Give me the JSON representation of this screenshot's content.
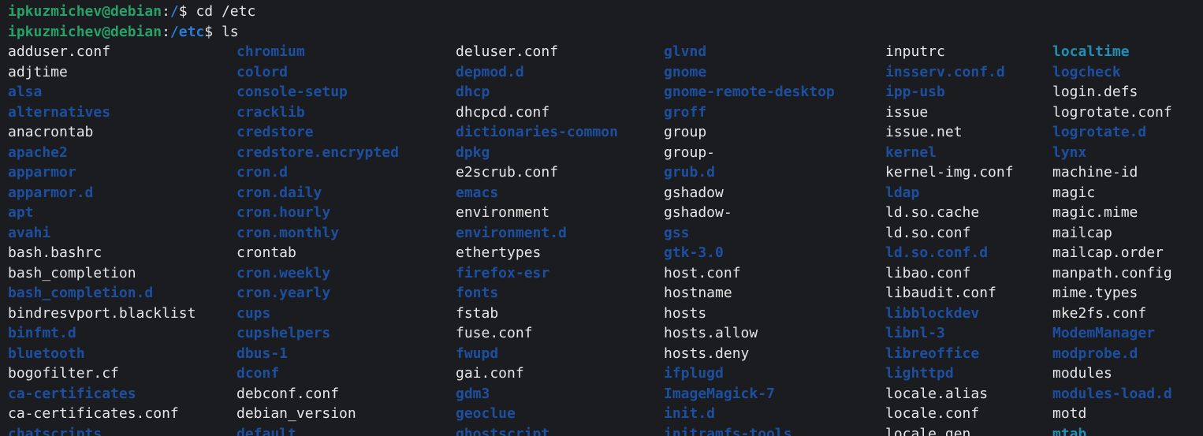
{
  "terminal": {
    "lines": [
      {
        "user_host": "ipkuzmichev@debian",
        "colon": ":",
        "path": "/",
        "dollar": "$ ",
        "command": "cd /etc"
      },
      {
        "user_host": "ipkuzmichev@debian",
        "colon": ":",
        "path": "/etc",
        "dollar": "$ ",
        "command": "ls"
      }
    ],
    "columns": [
      [
        {
          "name": "adduser.conf",
          "kind": "file"
        },
        {
          "name": "adjtime",
          "kind": "file"
        },
        {
          "name": "alsa",
          "kind": "dir"
        },
        {
          "name": "alternatives",
          "kind": "dir"
        },
        {
          "name": "anacrontab",
          "kind": "file"
        },
        {
          "name": "apache2",
          "kind": "dir"
        },
        {
          "name": "apparmor",
          "kind": "dir"
        },
        {
          "name": "apparmor.d",
          "kind": "dir"
        },
        {
          "name": "apt",
          "kind": "dir"
        },
        {
          "name": "avahi",
          "kind": "dir"
        },
        {
          "name": "bash.bashrc",
          "kind": "file"
        },
        {
          "name": "bash_completion",
          "kind": "file"
        },
        {
          "name": "bash_completion.d",
          "kind": "dir"
        },
        {
          "name": "bindresvport.blacklist",
          "kind": "file"
        },
        {
          "name": "binfmt.d",
          "kind": "dir"
        },
        {
          "name": "bluetooth",
          "kind": "dir"
        },
        {
          "name": "bogofilter.cf",
          "kind": "file"
        },
        {
          "name": "ca-certificates",
          "kind": "dir"
        },
        {
          "name": "ca-certificates.conf",
          "kind": "file"
        },
        {
          "name": "chatscripts",
          "kind": "dir"
        }
      ],
      [
        {
          "name": "chromium",
          "kind": "dir"
        },
        {
          "name": "colord",
          "kind": "dir"
        },
        {
          "name": "console-setup",
          "kind": "dir"
        },
        {
          "name": "cracklib",
          "kind": "dir"
        },
        {
          "name": "credstore",
          "kind": "dir"
        },
        {
          "name": "credstore.encrypted",
          "kind": "dir"
        },
        {
          "name": "cron.d",
          "kind": "dir"
        },
        {
          "name": "cron.daily",
          "kind": "dir"
        },
        {
          "name": "cron.hourly",
          "kind": "dir"
        },
        {
          "name": "cron.monthly",
          "kind": "dir"
        },
        {
          "name": "crontab",
          "kind": "file"
        },
        {
          "name": "cron.weekly",
          "kind": "dir"
        },
        {
          "name": "cron.yearly",
          "kind": "dir"
        },
        {
          "name": "cups",
          "kind": "dir"
        },
        {
          "name": "cupshelpers",
          "kind": "dir"
        },
        {
          "name": "dbus-1",
          "kind": "dir"
        },
        {
          "name": "dconf",
          "kind": "dir"
        },
        {
          "name": "debconf.conf",
          "kind": "file"
        },
        {
          "name": "debian_version",
          "kind": "file"
        },
        {
          "name": "default",
          "kind": "dir"
        }
      ],
      [
        {
          "name": "deluser.conf",
          "kind": "file"
        },
        {
          "name": "depmod.d",
          "kind": "dir"
        },
        {
          "name": "dhcp",
          "kind": "dir"
        },
        {
          "name": "dhcpcd.conf",
          "kind": "file"
        },
        {
          "name": "dictionaries-common",
          "kind": "dir"
        },
        {
          "name": "dpkg",
          "kind": "dir"
        },
        {
          "name": "e2scrub.conf",
          "kind": "file"
        },
        {
          "name": "emacs",
          "kind": "dir"
        },
        {
          "name": "environment",
          "kind": "file"
        },
        {
          "name": "environment.d",
          "kind": "dir"
        },
        {
          "name": "ethertypes",
          "kind": "file"
        },
        {
          "name": "firefox-esr",
          "kind": "dir"
        },
        {
          "name": "fonts",
          "kind": "dir"
        },
        {
          "name": "fstab",
          "kind": "file"
        },
        {
          "name": "fuse.conf",
          "kind": "file"
        },
        {
          "name": "fwupd",
          "kind": "dir"
        },
        {
          "name": "gai.conf",
          "kind": "file"
        },
        {
          "name": "gdm3",
          "kind": "dir"
        },
        {
          "name": "geoclue",
          "kind": "dir"
        },
        {
          "name": "ghostscript",
          "kind": "dir"
        }
      ],
      [
        {
          "name": "glvnd",
          "kind": "dir"
        },
        {
          "name": "gnome",
          "kind": "dir"
        },
        {
          "name": "gnome-remote-desktop",
          "kind": "dir"
        },
        {
          "name": "groff",
          "kind": "dir"
        },
        {
          "name": "group",
          "kind": "file"
        },
        {
          "name": "group-",
          "kind": "file"
        },
        {
          "name": "grub.d",
          "kind": "dir"
        },
        {
          "name": "gshadow",
          "kind": "file"
        },
        {
          "name": "gshadow-",
          "kind": "file"
        },
        {
          "name": "gss",
          "kind": "dir"
        },
        {
          "name": "gtk-3.0",
          "kind": "dir"
        },
        {
          "name": "host.conf",
          "kind": "file"
        },
        {
          "name": "hostname",
          "kind": "file"
        },
        {
          "name": "hosts",
          "kind": "file"
        },
        {
          "name": "hosts.allow",
          "kind": "file"
        },
        {
          "name": "hosts.deny",
          "kind": "file"
        },
        {
          "name": "ifplugd",
          "kind": "dir"
        },
        {
          "name": "ImageMagick-7",
          "kind": "dir"
        },
        {
          "name": "init.d",
          "kind": "dir"
        },
        {
          "name": "initramfs-tools",
          "kind": "dir"
        }
      ],
      [
        {
          "name": "inputrc",
          "kind": "file"
        },
        {
          "name": "insserv.conf.d",
          "kind": "dir"
        },
        {
          "name": "ipp-usb",
          "kind": "dir"
        },
        {
          "name": "issue",
          "kind": "file"
        },
        {
          "name": "issue.net",
          "kind": "file"
        },
        {
          "name": "kernel",
          "kind": "dir"
        },
        {
          "name": "kernel-img.conf",
          "kind": "file"
        },
        {
          "name": "ldap",
          "kind": "dir"
        },
        {
          "name": "ld.so.cache",
          "kind": "file"
        },
        {
          "name": "ld.so.conf",
          "kind": "file"
        },
        {
          "name": "ld.so.conf.d",
          "kind": "dir"
        },
        {
          "name": "libao.conf",
          "kind": "file"
        },
        {
          "name": "libaudit.conf",
          "kind": "file"
        },
        {
          "name": "libblockdev",
          "kind": "dir"
        },
        {
          "name": "libnl-3",
          "kind": "dir"
        },
        {
          "name": "libreoffice",
          "kind": "dir"
        },
        {
          "name": "lighttpd",
          "kind": "dir"
        },
        {
          "name": "locale.alias",
          "kind": "file"
        },
        {
          "name": "locale.conf",
          "kind": "file"
        },
        {
          "name": "locale.gen",
          "kind": "file"
        }
      ],
      [
        {
          "name": "localtime",
          "kind": "link"
        },
        {
          "name": "logcheck",
          "kind": "dir"
        },
        {
          "name": "login.defs",
          "kind": "file"
        },
        {
          "name": "logrotate.conf",
          "kind": "file"
        },
        {
          "name": "logrotate.d",
          "kind": "dir"
        },
        {
          "name": "lynx",
          "kind": "dir"
        },
        {
          "name": "machine-id",
          "kind": "file"
        },
        {
          "name": "magic",
          "kind": "file"
        },
        {
          "name": "magic.mime",
          "kind": "file"
        },
        {
          "name": "mailcap",
          "kind": "file"
        },
        {
          "name": "mailcap.order",
          "kind": "file"
        },
        {
          "name": "manpath.config",
          "kind": "file"
        },
        {
          "name": "mime.types",
          "kind": "file"
        },
        {
          "name": "mke2fs.conf",
          "kind": "file"
        },
        {
          "name": "ModemManager",
          "kind": "dir"
        },
        {
          "name": "modprobe.d",
          "kind": "dir"
        },
        {
          "name": "modules",
          "kind": "file"
        },
        {
          "name": "modules-load.d",
          "kind": "dir"
        },
        {
          "name": "motd",
          "kind": "file"
        },
        {
          "name": "mtab",
          "kind": "link"
        }
      ]
    ]
  }
}
